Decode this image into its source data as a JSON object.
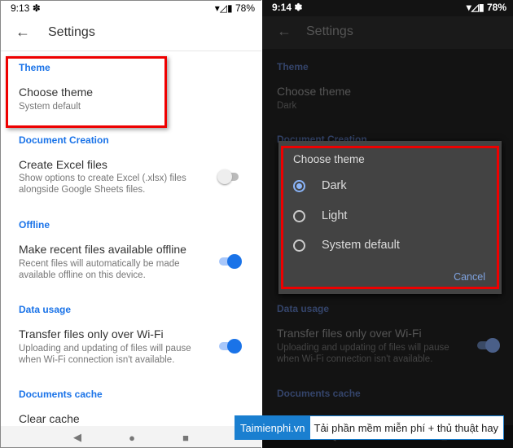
{
  "light": {
    "time": "9:13",
    "battery": "78%",
    "title": "Settings",
    "sections": [
      {
        "header": "Theme",
        "items": [
          {
            "title": "Choose theme",
            "subtitle": "System default"
          }
        ]
      },
      {
        "header": "Document Creation",
        "items": [
          {
            "title": "Create Excel files",
            "subtitle": "Show options to create Excel (.xlsx) files alongside Google Sheets files.",
            "toggle": false
          }
        ]
      },
      {
        "header": "Offline",
        "items": [
          {
            "title": "Make recent files available offline",
            "subtitle": "Recent files will automatically be made available offline on this device.",
            "toggle": true
          }
        ]
      },
      {
        "header": "Data usage",
        "items": [
          {
            "title": "Transfer files only over Wi-Fi",
            "subtitle": "Uploading and updating of files will pause when Wi-Fi connection isn't available.",
            "toggle": true
          }
        ]
      },
      {
        "header": "Documents cache",
        "items": [
          {
            "title": "Clear cache"
          }
        ]
      }
    ]
  },
  "dark": {
    "time": "9:14",
    "battery": "78%",
    "title": "Settings",
    "theme_header": "Theme",
    "choose_theme": "Choose theme",
    "theme_value": "Dark",
    "doc_header": "Document Creation",
    "data_header": "Data usage",
    "transfer_title": "Transfer files only over Wi-Fi",
    "transfer_sub": "Uploading and updating of files will pause when Wi-Fi connection isn't available.",
    "cache_header": "Documents cache",
    "dialog": {
      "title": "Choose theme",
      "options": [
        "Dark",
        "Light",
        "System default"
      ],
      "selected": "Dark",
      "cancel": "Cancel"
    }
  },
  "banner": {
    "brand": "Taimienphi.vn",
    "tagline": "Tải phần mềm miễn phí + thủ thuật hay"
  },
  "colors": {
    "accent": "#1a73e8",
    "highlight": "#e00000",
    "dialog_bg": "#434343"
  }
}
